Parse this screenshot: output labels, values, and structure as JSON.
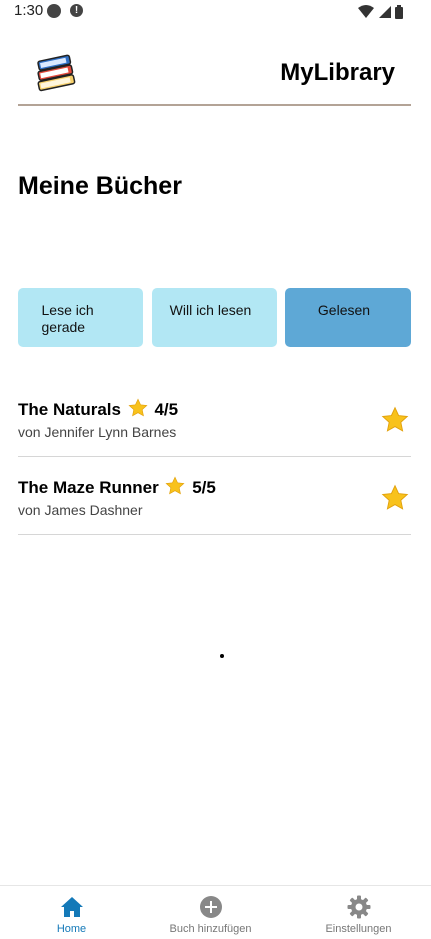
{
  "status_bar": {
    "time": "1:30"
  },
  "header": {
    "app_title": "MyLibrary",
    "logo_icon": "books-icon"
  },
  "page": {
    "title": "Meine Bücher"
  },
  "tabs": [
    {
      "label": "Lese ich gerade",
      "active": false
    },
    {
      "label": "Will ich lesen",
      "active": false
    },
    {
      "label": "Gelesen",
      "active": true
    }
  ],
  "books": [
    {
      "title": "The Naturals",
      "rating": "4/5",
      "author": "von Jennifer Lynn Barnes",
      "favorite": true
    },
    {
      "title": "The Maze Runner",
      "rating": "5/5",
      "author": "von James Dashner",
      "favorite": true
    }
  ],
  "bottom_nav": [
    {
      "label": "Home",
      "icon": "home-icon",
      "active": true
    },
    {
      "label": "Buch hinzufügen",
      "icon": "add-circle-icon",
      "active": false
    },
    {
      "label": "Einstellungen",
      "icon": "gear-icon",
      "active": false
    }
  ],
  "colors": {
    "tab_inactive": "#b2e7f4",
    "tab_active": "#5ea8d6",
    "nav_active": "#1479b8",
    "star": "#f8c21c",
    "divider": "#b3a396"
  }
}
